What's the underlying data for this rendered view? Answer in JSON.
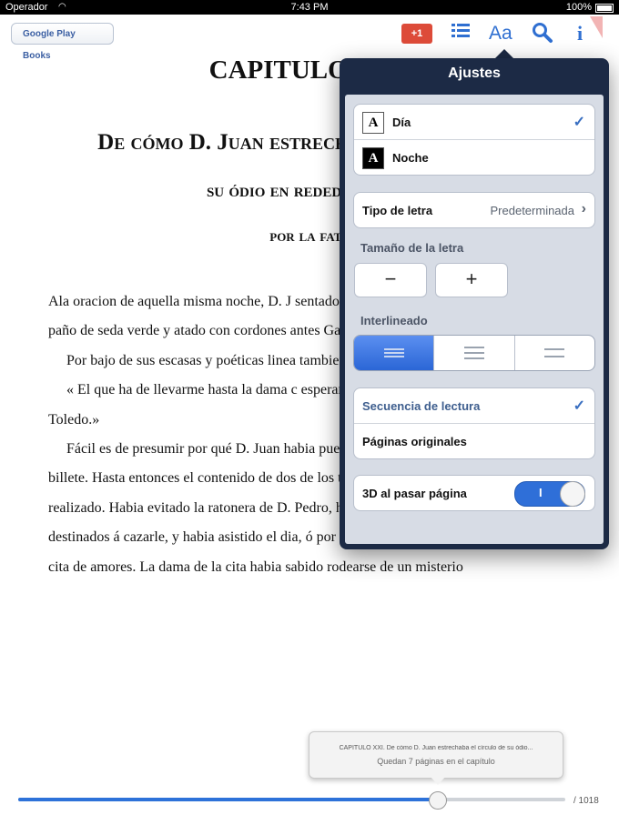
{
  "status_bar": {
    "carrier": "Operador",
    "time": "7:43 PM",
    "battery": "100%"
  },
  "toolbar": {
    "back_label": "Google Play Books",
    "gplus_label": "+1",
    "icons": [
      "contents-list-icon",
      "font-settings-icon",
      "search-icon",
      "info-icon"
    ],
    "font_icon_text": "Aa"
  },
  "book": {
    "chapter_title": "CAPITULO XXI.",
    "subtitle_lines": [
      "De cómo D. Juan estrechaba el círculo de",
      "su ódio en rededor de Al",
      "por la fata"
    ],
    "paragraphs": [
      "Ala oracion de aquella misma noche, D. J sentado junto á su mesa, y teniendo delan paño de seda verde y atado con cordones antes Gabilan.",
      "Por bajo de sus escasas y poéticas linea tambien en árabe:",
      "« El que ha de llevarme hasta la dama c esperará durante tres noches seguidas á l Toledo.»",
      "Fácil es de presumir por qué D. Juan habia puesto esta nota y daba vuelta á este billete. Hasta entonces el contenido de dos de los tres que habia recibido, estaba realizado. Habia evitado la ratonera de D. Pedro, haciéndose servidores de los mismos destinados á cazarle, y habia asistido el dia, ó por mejor decir, la noche siguiente, á una cita de amores. La dama de la cita habia sabido rodearse de un misterio"
    ]
  },
  "settings": {
    "title": "Ajustes",
    "themes": [
      {
        "label": "Día",
        "swatch": "A",
        "selected": true
      },
      {
        "label": "Noche",
        "swatch": "A",
        "selected": false
      }
    ],
    "font_type": {
      "label": "Tipo de letra",
      "value": "Predeterminada"
    },
    "font_size": {
      "label": "Tamaño de la letra",
      "decrease": "−",
      "increase": "+"
    },
    "line_spacing": {
      "label": "Interlineado",
      "options": [
        "compact",
        "normal",
        "wide"
      ],
      "selected_index": 0
    },
    "reading_modes": [
      {
        "label": "Secuencia de lectura",
        "selected": true
      },
      {
        "label": "Páginas originales",
        "selected": false
      }
    ],
    "page_turn_3d": {
      "label": "3D al pasar página",
      "enabled": true,
      "on_text": "I"
    }
  },
  "progress": {
    "tooltip_chapter": "CAPITULO XXI. De cómo D. Juan estrechaba el círculo de su ódio...",
    "tooltip_remaining": "Quedan 7 páginas en el capítulo",
    "total_pages": "/ 1018",
    "position_fraction": 0.765
  },
  "colors": {
    "accent": "#2f6fd8",
    "popover_frame": "#1c2a45",
    "popover_body": "#d7dce5"
  }
}
